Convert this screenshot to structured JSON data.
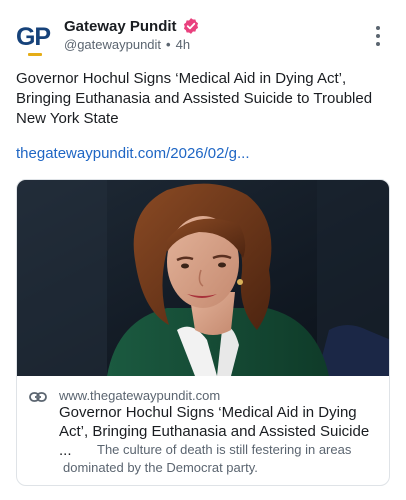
{
  "author": {
    "display_name": "Gateway Pundit",
    "handle": "@gatewaypundit",
    "time": "4h",
    "separator": "•",
    "avatar_text": "GP",
    "verified": true,
    "verified_color": "#e9417e"
  },
  "post": {
    "text": "Governor Hochul Signs ‘Medical Aid in Dying Act’, Bringing Euthanasia and Assisted Suicide to Troubled New York State",
    "link": "thegatewaypundit.com/2026/02/g..."
  },
  "card": {
    "domain": "www.thegatewaypundit.com",
    "title": "Governor Hochul Signs ‘Medical Aid in Dying Act’, Bringing Euthanasia and Assisted Suicide ...",
    "description": "The culture of death is still festering in areas dominated by the Democrat party.",
    "image_subject": "woman-with-auburn-hair-in-green-jacket-interview"
  },
  "colors": {
    "link": "#1f66c4",
    "brand_blue": "#16427a",
    "brand_gold": "#e5ad17"
  },
  "icons": {
    "more": "more-vertical-icon",
    "link": "link-chain-icon",
    "verified": "verified-badge-icon"
  }
}
